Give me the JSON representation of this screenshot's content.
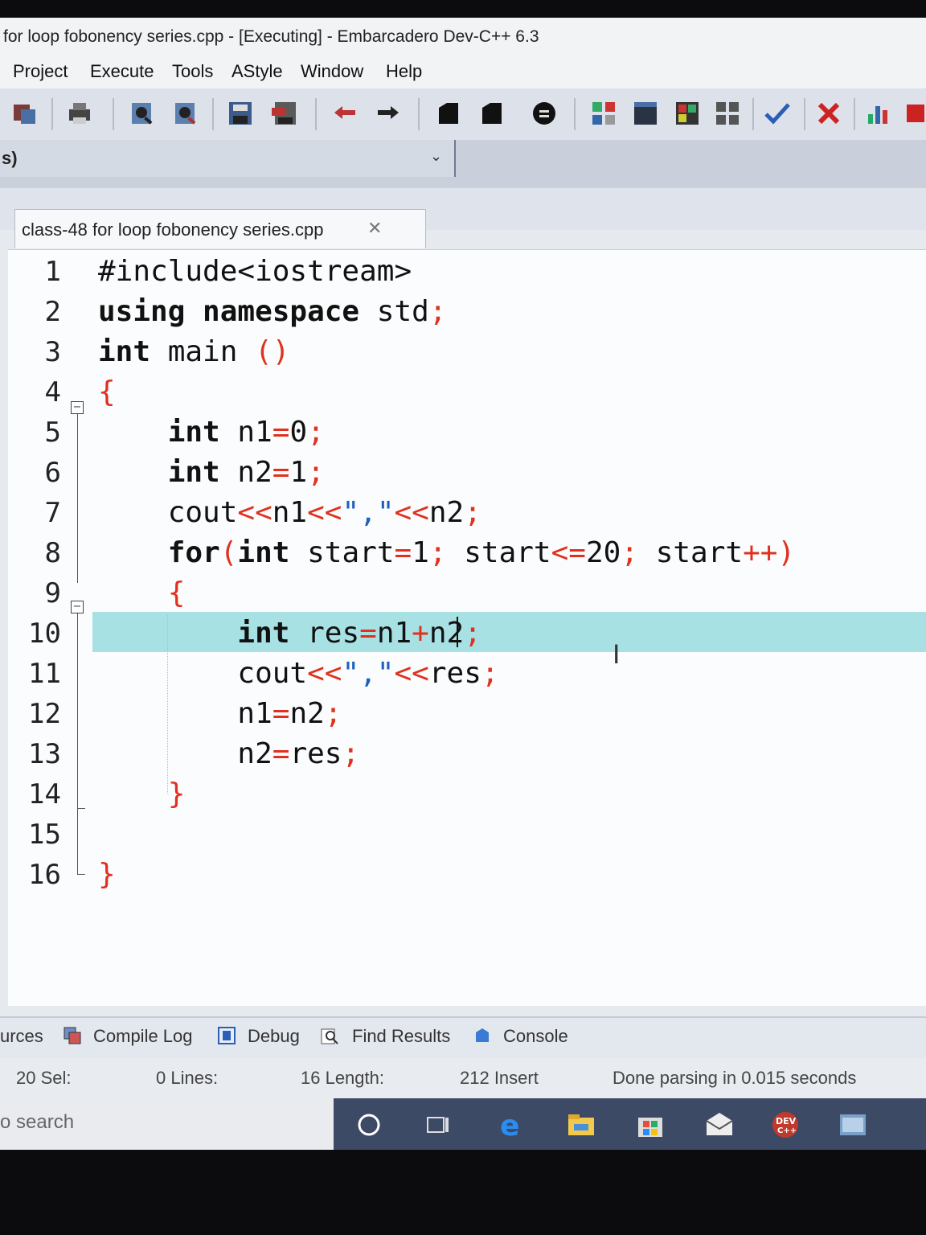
{
  "window": {
    "title": "for loop fobonency series.cpp - [Executing] - Embarcadero Dev-C++ 6.3"
  },
  "menu": [
    "Project",
    "Execute",
    "Tools",
    "AStyle",
    "Window",
    "Help"
  ],
  "toolbar_icons": [
    "new-project-icon",
    "print-icon",
    "find-icon",
    "replace-icon",
    "save-icon",
    "save-all-icon",
    "undo-icon",
    "redo-icon",
    "bookmark-icon",
    "bookmark-2-icon",
    "stop-icon",
    "grid-icon",
    "window-icon",
    "color-grid-icon",
    "tiles-icon",
    "check-icon",
    "delete-icon",
    "chart-icon",
    "close-red-icon"
  ],
  "project_select": {
    "value": "s)"
  },
  "tab": {
    "label": "class-48 for loop fobonency series.cpp"
  },
  "editor": {
    "line_numbers": [
      "1",
      "2",
      "3",
      "4",
      "5",
      "6",
      "7",
      "8",
      "9",
      "10",
      "11",
      "12",
      "13",
      "14",
      "15",
      "16"
    ],
    "current_line": 10
  },
  "bottom_tabs": [
    "urces",
    "Compile Log",
    "Debug",
    "Find Results",
    "Console"
  ],
  "status": {
    "sel": "20 Sel:",
    "lines": "0 Lines:",
    "length": "16 Length:",
    "insert": "212 Insert",
    "message": "Done parsing in 0.015 seconds"
  },
  "taskbar": {
    "search_text": "o search"
  },
  "colors": {
    "current_line": "#a7e1e3",
    "operator": "#e0301e",
    "string": "#1c5fbf",
    "taskbar": "#3c4a66"
  }
}
